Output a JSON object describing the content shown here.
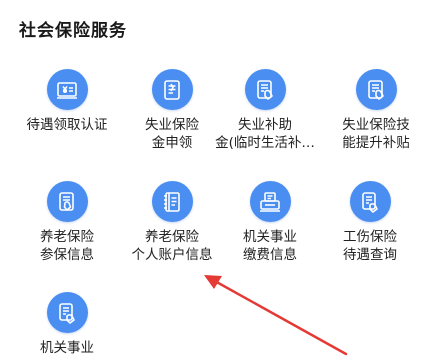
{
  "section": {
    "title": "社会保险服务"
  },
  "services": [
    {
      "line1": "待遇领取认证",
      "line2": "",
      "icon": "yuan-card-icon"
    },
    {
      "line1": "失业保险",
      "line2": "金申领",
      "icon": "document-icon"
    },
    {
      "line1": "失业补助",
      "line2": "金(临时生活补…",
      "icon": "phone-document-icon"
    },
    {
      "line1": "失业保险技",
      "line2": "能提升补贴",
      "icon": "phone-document-icon"
    },
    {
      "line1": "养老保险",
      "line2": "参保信息",
      "icon": "phone-document-icon"
    },
    {
      "line1": "养老保险",
      "line2": "个人账户信息",
      "icon": "book-icon"
    },
    {
      "line1": "机关事业",
      "line2": "缴费信息",
      "icon": "printer-icon"
    },
    {
      "line1": "工伤保险",
      "line2": "待遇查询",
      "icon": "hand-document-icon"
    },
    {
      "line1": "机关事业",
      "line2": "",
      "icon": "hand-document-icon"
    }
  ],
  "colors": {
    "icon_background": "#4a8ef2",
    "annotation_arrow": "#e53935"
  }
}
